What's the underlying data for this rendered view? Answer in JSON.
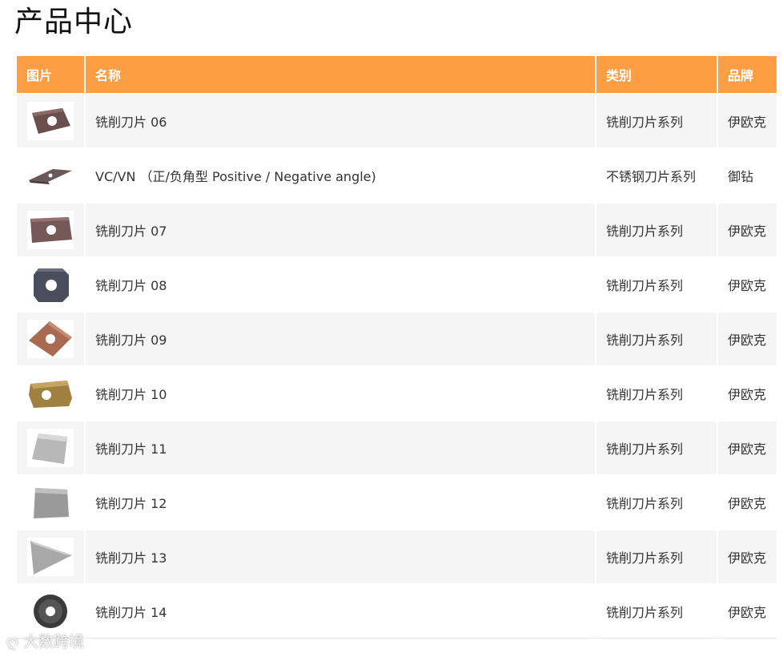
{
  "page": {
    "title": "产品中心"
  },
  "table": {
    "headers": {
      "image": "图片",
      "name": "名称",
      "category": "类别",
      "brand": "品牌"
    },
    "rows": [
      {
        "name": "铣削刀片 06",
        "category": "铣削刀片系列",
        "brand": "伊欧克",
        "thumb_icon": "brown-rhombic-insert-icon",
        "thumb_color": "#6b4f4f"
      },
      {
        "name": "VC/VN （正/负角型 Positive / Negative angle)",
        "category": "不锈钢刀片系列",
        "brand": "御钻",
        "thumb_icon": "diamond-insert-icon",
        "thumb_color": "#6a5858"
      },
      {
        "name": "铣削刀片 07",
        "category": "铣削刀片系列",
        "brand": "伊欧克",
        "thumb_icon": "brown-rectangular-insert-icon",
        "thumb_color": "#755858"
      },
      {
        "name": "铣削刀片 08",
        "category": "铣削刀片系列",
        "brand": "伊欧克",
        "thumb_icon": "dark-octagonal-insert-icon",
        "thumb_color": "#4a4d5c"
      },
      {
        "name": "铣削刀片 09",
        "category": "铣削刀片系列",
        "brand": "伊欧克",
        "thumb_icon": "copper-square-insert-icon",
        "thumb_color": "#a86a50"
      },
      {
        "name": "铣削刀片 10",
        "category": "铣削刀片系列",
        "brand": "伊欧克",
        "thumb_icon": "gold-insert-icon",
        "thumb_color": "#a08040"
      },
      {
        "name": "铣削刀片 11",
        "category": "铣削刀片系列",
        "brand": "伊欧克",
        "thumb_icon": "silver-square-insert-icon",
        "thumb_color": "#b8b8b8"
      },
      {
        "name": "铣削刀片 12",
        "category": "铣削刀片系列",
        "brand": "伊欧克",
        "thumb_icon": "gray-square-insert-icon",
        "thumb_color": "#9a9a9a"
      },
      {
        "name": "铣削刀片 13",
        "category": "铣削刀片系列",
        "brand": "伊欧克",
        "thumb_icon": "triangular-insert-icon",
        "thumb_color": "#a8a8a8"
      },
      {
        "name": "铣削刀片 14",
        "category": "铣削刀片系列",
        "brand": "伊欧克",
        "thumb_icon": "round-insert-icon",
        "thumb_color": "#3a3a3a"
      }
    ]
  },
  "watermark": {
    "text": "大数跨境"
  },
  "colors": {
    "header_bg": "#fd9d44",
    "row_alt": "#f5f5f5"
  }
}
